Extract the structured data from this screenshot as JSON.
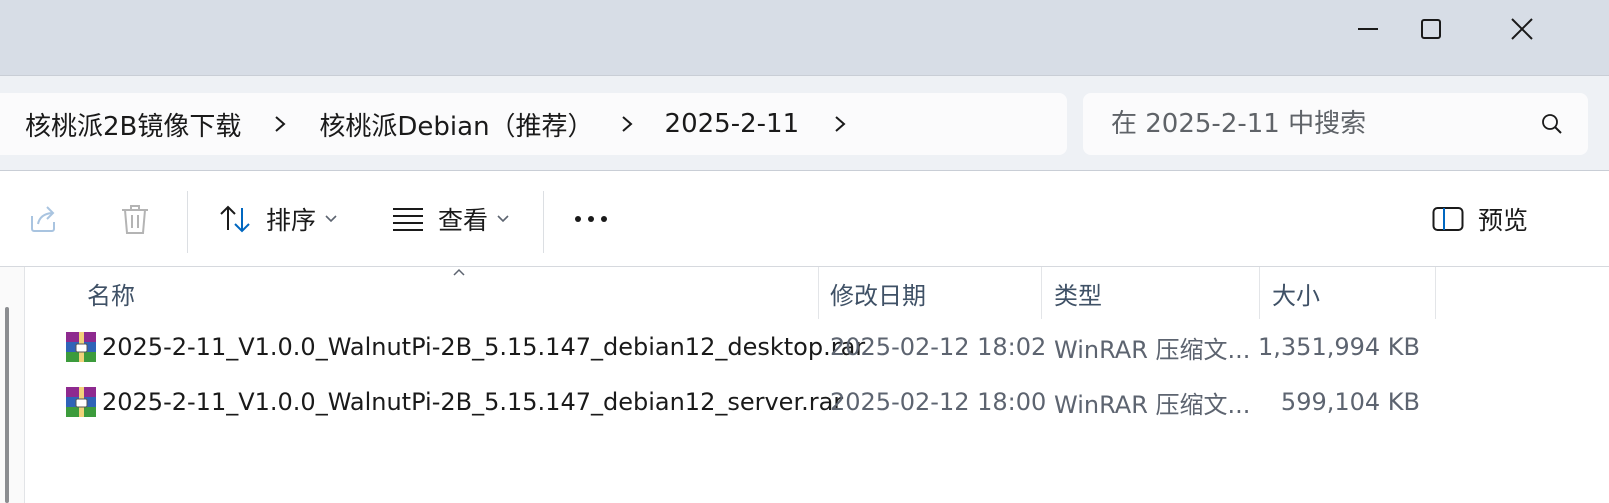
{
  "window": {
    "controls": {
      "minimize": "minimize-icon",
      "maximize": "maximize-icon",
      "close": "close-icon"
    }
  },
  "breadcrumb": {
    "items": [
      "核桃派2B镜像下载",
      "核桃派Debian（推荐）",
      "2025-2-11"
    ],
    "separator_icon": "chevron-right-icon"
  },
  "search": {
    "placeholder": "在 2025-2-11 中搜索",
    "icon": "search-icon"
  },
  "toolbar": {
    "share_icon": "share-icon",
    "delete_icon": "trash-icon",
    "sort_label": "排序",
    "view_label": "查看",
    "more_icon": "more-icon",
    "preview_label": "预览"
  },
  "columns": {
    "name": "名称",
    "modified": "修改日期",
    "type": "类型",
    "size": "大小"
  },
  "files": [
    {
      "name": "2025-2-11_V1.0.0_WalnutPi-2B_5.15.147_debian12_desktop.rar",
      "modified": "2025-02-12 18:02",
      "type": "WinRAR 压缩文...",
      "size": "1,351,994 KB",
      "icon": "winrar-archive-icon"
    },
    {
      "name": "2025-2-11_V1.0.0_WalnutPi-2B_5.15.147_debian12_server.rar",
      "modified": "2025-02-12 18:00",
      "type": "WinRAR 压缩文...",
      "size": "599,104 KB",
      "icon": "winrar-archive-icon"
    }
  ],
  "colors": {
    "titlebar": "#d7dde6",
    "address_bar": "#eef1f5",
    "accent": "#0067c0",
    "header_text": "#3f5166"
  }
}
